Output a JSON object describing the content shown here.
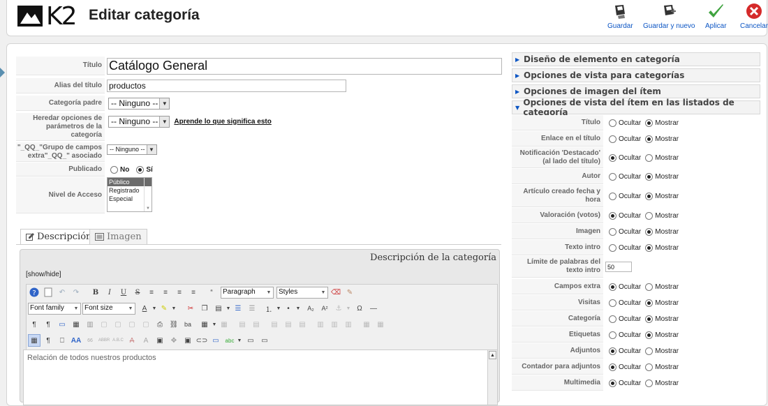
{
  "header": {
    "logo_text": "K2",
    "title": "Editar categoría",
    "toolbar": [
      {
        "label": "Guardar",
        "icon": "save-icon"
      },
      {
        "label": "Guardar y nuevo",
        "icon": "save-new-icon"
      },
      {
        "label": "Aplicar",
        "icon": "apply-check-icon"
      },
      {
        "label": "Cancelar",
        "icon": "cancel-icon"
      }
    ]
  },
  "form": {
    "title_label": "Título",
    "title_value": "Catálogo General",
    "alias_label": "Alias del título",
    "alias_value": "productos",
    "parent_label": "Categoría padre",
    "parent_value": "-- Ninguno --",
    "inherit_label": "Heredar opciones de parámetros de la categoría",
    "inherit_value": "-- Ninguno --",
    "inherit_link": "Aprende lo que significa esto",
    "extra_group_label": "\"_QQ_\"Grupo de campos extra\"_QQ_\" asociado",
    "extra_group_value": "-- Ninguno --",
    "published_label": "Publicado",
    "published_no": "No",
    "published_yes": "Sí",
    "access_label": "Nivel de Acceso",
    "access_options": [
      "Público",
      "Registrado",
      "Especial"
    ]
  },
  "tabs": {
    "description": "Descripción",
    "image": "Imagen"
  },
  "editor": {
    "title": "Descripción de la categoría",
    "toggle": "[show/hide]",
    "paragraph": "Paragraph",
    "styles": "Styles",
    "font_family": "Font family",
    "font_size": "Font size",
    "content": "Relación de todos nuestros productos"
  },
  "right": {
    "sections": [
      "Diseño de elemento en categoría",
      "Opciones de vista para categorías",
      "Opciones de imagen del ítem",
      "Opciones de vista del ítem en las listados de categoría"
    ],
    "hide_label": "Ocultar",
    "show_label": "Mostrar",
    "limit_label": "Límite de palabras del texto intro",
    "limit_value": "50",
    "options": [
      {
        "label": "Título",
        "value": "show"
      },
      {
        "label": "Enlace en el título",
        "value": "show"
      },
      {
        "label": "Notificación 'Destacado' (al lado del título)",
        "value": "hide"
      },
      {
        "label": "Autor",
        "value": "show"
      },
      {
        "label": "Artículo creado fecha y hora",
        "value": "show"
      },
      {
        "label": "Valoración (votos)",
        "value": "hide"
      },
      {
        "label": "Imagen",
        "value": "show"
      },
      {
        "label": "Texto intro",
        "value": "show"
      },
      {
        "label": "Campos extra",
        "value": "hide"
      },
      {
        "label": "Visitas",
        "value": "show"
      },
      {
        "label": "Categoría",
        "value": "show"
      },
      {
        "label": "Etiquetas",
        "value": "show"
      },
      {
        "label": "Adjuntos",
        "value": "hide"
      },
      {
        "label": "Contador para adjuntos",
        "value": "hide"
      },
      {
        "label": "Multimedia",
        "value": "hide"
      }
    ]
  }
}
